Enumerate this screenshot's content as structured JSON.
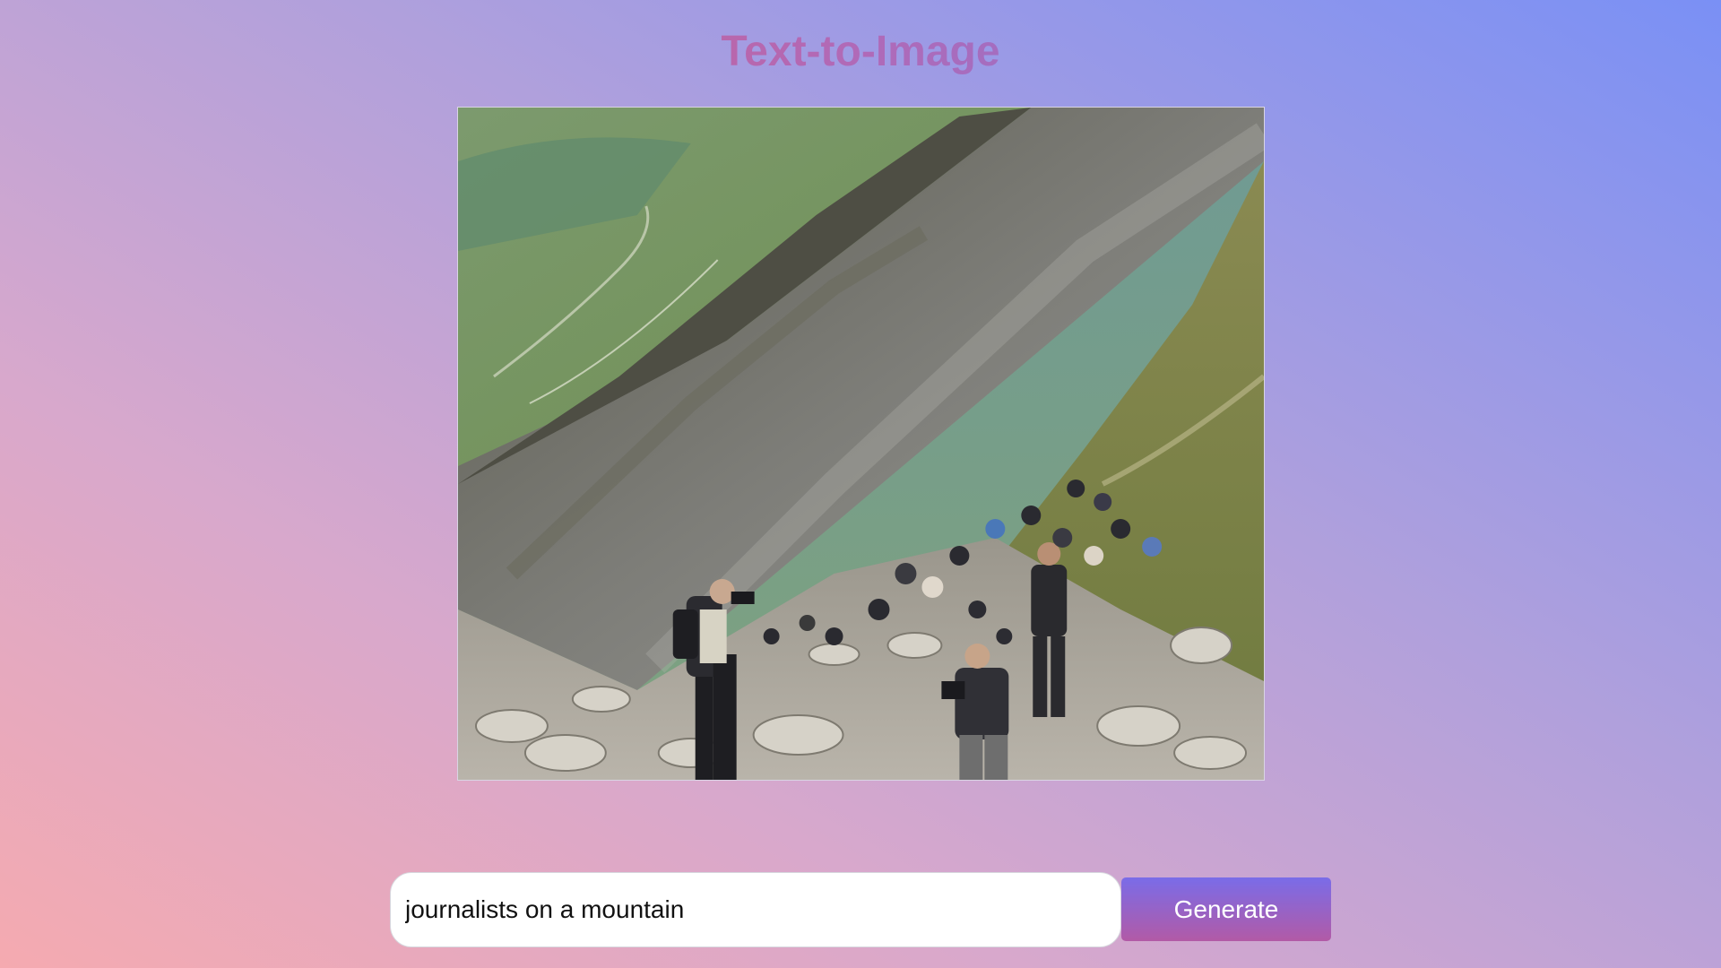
{
  "app": {
    "title": "Text-to-Image"
  },
  "generated_image": {
    "subject": "journalists on a mountain"
  },
  "prompt": {
    "value": "journalists on a mountain",
    "placeholder": ""
  },
  "actions": {
    "generate_label": "Generate"
  },
  "colors": {
    "title_gradient": [
      "#e5566e",
      "#b06ab8",
      "#6a7fe6"
    ],
    "button_gradient": [
      "#7a6ce8",
      "#b25aa6"
    ],
    "background_gradient": [
      "#f5aab0",
      "#d8a8cc",
      "#b0a0dc",
      "#7a90f5"
    ]
  }
}
